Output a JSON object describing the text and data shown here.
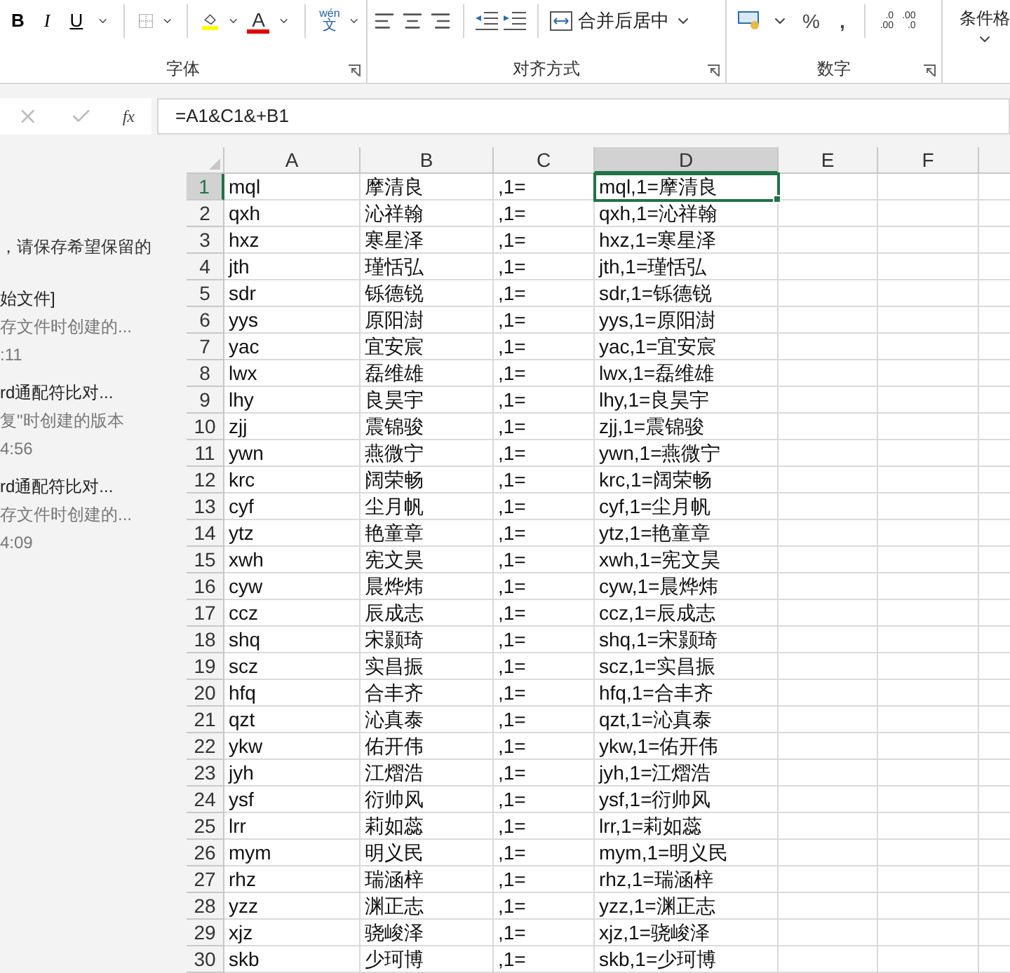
{
  "ribbon": {
    "font": {
      "bold": "B",
      "italic": "I",
      "underline": "U",
      "font_color": "A",
      "phonetic_top": "wén",
      "phonetic_bottom": "文",
      "label": "字体"
    },
    "alignment": {
      "merge": "合并后居中",
      "label": "对齐方式"
    },
    "number": {
      "percent": "%",
      "comma": ",",
      "increase_decimal": [
        ".0",
        ".00"
      ],
      "decrease_decimal": [
        ".00",
        ".0"
      ],
      "label": "数字"
    },
    "styles": {
      "label": "条件格"
    }
  },
  "formula_bar": {
    "function_label": "fx",
    "value": "=A1&C1&+B1"
  },
  "side_pane": {
    "notice": "，请保存希望保留的",
    "versions": [
      {
        "title": "始文件]",
        "subtitle": "存文件时创建的...",
        "time": ":11"
      },
      {
        "title": "rd通配符比对...",
        "subtitle": "复\"时创建的版本",
        "time": "4:56"
      },
      {
        "title": "rd通配符比对...",
        "subtitle": "存文件时创建的...",
        "time": "4:09"
      }
    ]
  },
  "sheet": {
    "columns": [
      {
        "label": "A",
        "selected": false
      },
      {
        "label": "B",
        "selected": false
      },
      {
        "label": "C",
        "selected": false
      },
      {
        "label": "D",
        "selected": true
      },
      {
        "label": "E",
        "selected": false
      },
      {
        "label": "F",
        "selected": false
      }
    ],
    "rows": [
      {
        "number": "1",
        "selected": true,
        "cells": [
          "mql",
          "摩清良",
          ",1=",
          "mql,1=摩清良"
        ]
      },
      {
        "number": "2",
        "selected": false,
        "cells": [
          "qxh",
          "沁祥翰",
          ",1=",
          "qxh,1=沁祥翰"
        ]
      },
      {
        "number": "3",
        "selected": false,
        "cells": [
          "hxz",
          "寒星泽",
          ",1=",
          "hxz,1=寒星泽"
        ]
      },
      {
        "number": "4",
        "selected": false,
        "cells": [
          "jth",
          "瑾恬弘",
          ",1=",
          "jth,1=瑾恬弘"
        ]
      },
      {
        "number": "5",
        "selected": false,
        "cells": [
          "sdr",
          "铄德锐",
          ",1=",
          "sdr,1=铄德锐"
        ]
      },
      {
        "number": "6",
        "selected": false,
        "cells": [
          "yys",
          "原阳澍",
          ",1=",
          "yys,1=原阳澍"
        ]
      },
      {
        "number": "7",
        "selected": false,
        "cells": [
          "yac",
          "宜安宸",
          ",1=",
          "yac,1=宜安宸"
        ]
      },
      {
        "number": "8",
        "selected": false,
        "cells": [
          "lwx",
          "磊维雄",
          ",1=",
          "lwx,1=磊维雄"
        ]
      },
      {
        "number": "9",
        "selected": false,
        "cells": [
          "lhy",
          "良昊宇",
          ",1=",
          "lhy,1=良昊宇"
        ]
      },
      {
        "number": "10",
        "selected": false,
        "cells": [
          "zjj",
          "震锦骏",
          ",1=",
          "zjj,1=震锦骏"
        ]
      },
      {
        "number": "11",
        "selected": false,
        "cells": [
          "ywn",
          "燕微宁",
          ",1=",
          "ywn,1=燕微宁"
        ]
      },
      {
        "number": "12",
        "selected": false,
        "cells": [
          "krc",
          "阔荣畅",
          ",1=",
          "krc,1=阔荣畅"
        ]
      },
      {
        "number": "13",
        "selected": false,
        "cells": [
          "cyf",
          "尘月帆",
          ",1=",
          "cyf,1=尘月帆"
        ]
      },
      {
        "number": "14",
        "selected": false,
        "cells": [
          "ytz",
          "艳童章",
          ",1=",
          "ytz,1=艳童章"
        ]
      },
      {
        "number": "15",
        "selected": false,
        "cells": [
          "xwh",
          "宪文昊",
          ",1=",
          "xwh,1=宪文昊"
        ]
      },
      {
        "number": "16",
        "selected": false,
        "cells": [
          "cyw",
          "晨烨炜",
          ",1=",
          "cyw,1=晨烨炜"
        ]
      },
      {
        "number": "17",
        "selected": false,
        "cells": [
          "ccz",
          "辰成志",
          ",1=",
          "ccz,1=辰成志"
        ]
      },
      {
        "number": "18",
        "selected": false,
        "cells": [
          "shq",
          "宋颢琦",
          ",1=",
          "shq,1=宋颢琦"
        ]
      },
      {
        "number": "19",
        "selected": false,
        "cells": [
          "scz",
          "实昌振",
          ",1=",
          "scz,1=实昌振"
        ]
      },
      {
        "number": "20",
        "selected": false,
        "cells": [
          "hfq",
          "合丰齐",
          ",1=",
          "hfq,1=合丰齐"
        ]
      },
      {
        "number": "21",
        "selected": false,
        "cells": [
          "qzt",
          "沁真泰",
          ",1=",
          "qzt,1=沁真泰"
        ]
      },
      {
        "number": "22",
        "selected": false,
        "cells": [
          "ykw",
          "佑开伟",
          ",1=",
          "ykw,1=佑开伟"
        ]
      },
      {
        "number": "23",
        "selected": false,
        "cells": [
          "jyh",
          "江熠浩",
          ",1=",
          "jyh,1=江熠浩"
        ]
      },
      {
        "number": "24",
        "selected": false,
        "cells": [
          "ysf",
          "衍帅风",
          ",1=",
          "ysf,1=衍帅风"
        ]
      },
      {
        "number": "25",
        "selected": false,
        "cells": [
          "lrr",
          "莉如蕊",
          ",1=",
          "lrr,1=莉如蕊"
        ]
      },
      {
        "number": "26",
        "selected": false,
        "cells": [
          "mym",
          "明义民",
          ",1=",
          "mym,1=明义民"
        ]
      },
      {
        "number": "27",
        "selected": false,
        "cells": [
          "rhz",
          "瑞涵梓",
          ",1=",
          "rhz,1=瑞涵梓"
        ]
      },
      {
        "number": "28",
        "selected": false,
        "cells": [
          "yzz",
          "渊正志",
          ",1=",
          "yzz,1=渊正志"
        ]
      },
      {
        "number": "29",
        "selected": false,
        "cells": [
          "xjz",
          "骁峻泽",
          ",1=",
          "xjz,1=骁峻泽"
        ]
      },
      {
        "number": "30",
        "selected": false,
        "cells": [
          "skb",
          "少珂博",
          ",1=",
          "skb,1=少珂博"
        ]
      }
    ]
  }
}
